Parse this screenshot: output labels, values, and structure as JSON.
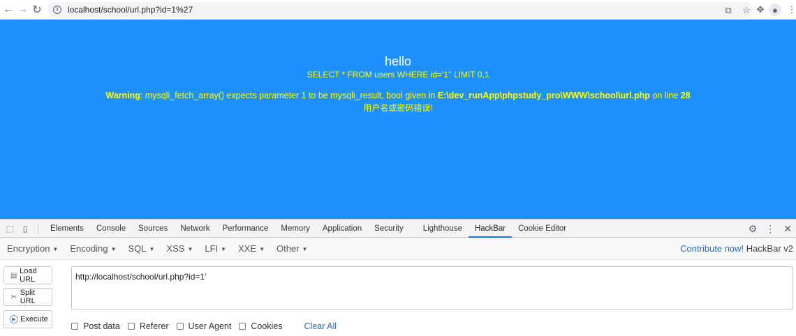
{
  "browser": {
    "url": "localhost/school/url.php?id=1%27"
  },
  "page": {
    "hello": "hello",
    "sql": "SELECT * FROM users WHERE id='1'' LIMIT 0,1",
    "warning_label": "Warning",
    "warning_text_1": ": mysqli_fetch_array() expects parameter 1 to be mysqli_result, bool given in ",
    "warning_path": "E:\\dev_runApp\\phpstudy_pro\\WWW\\school\\url.php",
    "warning_text_2": " on line ",
    "warning_line": "28",
    "cn_message": "用户名或密码错误!"
  },
  "devtools": {
    "tabs": [
      "Elements",
      "Console",
      "Sources",
      "Network",
      "Performance",
      "Memory",
      "Application",
      "Security",
      "Lighthouse",
      "HackBar",
      "Cookie Editor"
    ],
    "active_tab": "HackBar"
  },
  "hackbar": {
    "menu": [
      "Encryption",
      "Encoding",
      "SQL",
      "XSS",
      "LFI",
      "XXE",
      "Other"
    ],
    "contribute": "Contribute now!",
    "version": "HackBar v2",
    "load_url": "Load URL",
    "split_url": "Split URL",
    "execute": "Execute",
    "url_value": "http://localhost/school/url.php?id=1'",
    "options": [
      "Post data",
      "Referer",
      "User Agent",
      "Cookies"
    ],
    "clear_all": "Clear All"
  }
}
